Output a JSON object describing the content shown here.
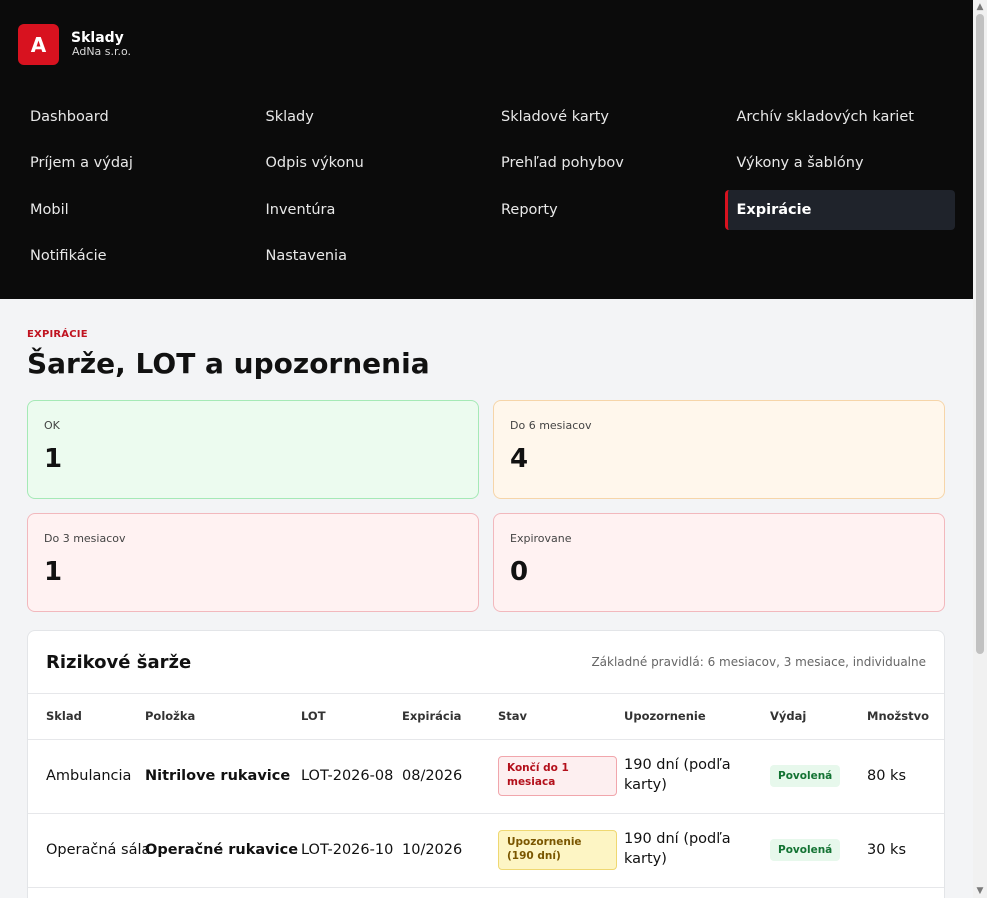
{
  "brand": {
    "logo_letter": "A",
    "name": "Sklady",
    "company": "AdNa s.r.o."
  },
  "nav": {
    "items": [
      {
        "label": "Dashboard",
        "key": "dashboard"
      },
      {
        "label": "Sklady",
        "key": "sklady"
      },
      {
        "label": "Skladové karty",
        "key": "skladove-karty"
      },
      {
        "label": "Archív skladových kariet",
        "key": "archiv"
      },
      {
        "label": "Príjem a výdaj",
        "key": "prijem-vydaj"
      },
      {
        "label": "Odpis výkonu",
        "key": "odpis-vykonu"
      },
      {
        "label": "Prehľad pohybov",
        "key": "prehlad-pohybov"
      },
      {
        "label": "Výkony a šablóny",
        "key": "vykony-sablony"
      },
      {
        "label": "Mobil",
        "key": "mobil"
      },
      {
        "label": "Inventúra",
        "key": "inventura"
      },
      {
        "label": "Reporty",
        "key": "reporty"
      },
      {
        "label": "Expirácie",
        "key": "expiracie",
        "active": true
      },
      {
        "label": "Notifikácie",
        "key": "notifikacie"
      },
      {
        "label": "Nastavenia",
        "key": "nastavenia"
      }
    ]
  },
  "page": {
    "eyebrow": "EXPIRÁCIE",
    "title": "Šarže, LOT a upozornenia"
  },
  "cards": {
    "ok": {
      "label": "OK",
      "value": "1"
    },
    "six_months": {
      "label": "Do 6 mesiacov",
      "value": "4"
    },
    "three_months": {
      "label": "Do 3 mesiacov",
      "value": "1"
    },
    "expired": {
      "label": "Expirovane",
      "value": "0"
    }
  },
  "panel": {
    "title": "Rizikové šarže",
    "note": "Základné pravidlá: 6 mesiacov, 3 mesiace, individualne",
    "columns": [
      "Sklad",
      "Položka",
      "LOT",
      "Expirácia",
      "Stav",
      "Upozornenie",
      "Výdaj",
      "Množstvo"
    ],
    "rows": [
      {
        "sklad": "Ambulancia",
        "polozka": "Nitrilove rukavice",
        "lot": "LOT-2026-08",
        "expiracia": "08/2026",
        "stav": "Končí do 1 mesiaca",
        "stav_tone": "red",
        "upozornenie": "190 dní (podľa karty)",
        "vydaj": "Povolená",
        "mnozstvo": "80 ks"
      },
      {
        "sklad": "Operačná sála",
        "polozka": "Operačné rukavice",
        "lot": "LOT-2026-10",
        "expiracia": "10/2026",
        "stav": "Upozornenie (190 dní)",
        "stav_tone": "yellow",
        "upozornenie": "190 dní (podľa karty)",
        "vydaj": "Povolená",
        "mnozstvo": "30 ks"
      }
    ]
  },
  "colors": {
    "accent": "#d8121f",
    "header_bg": "#0b0b0b",
    "page_bg": "#f3f4f6"
  }
}
